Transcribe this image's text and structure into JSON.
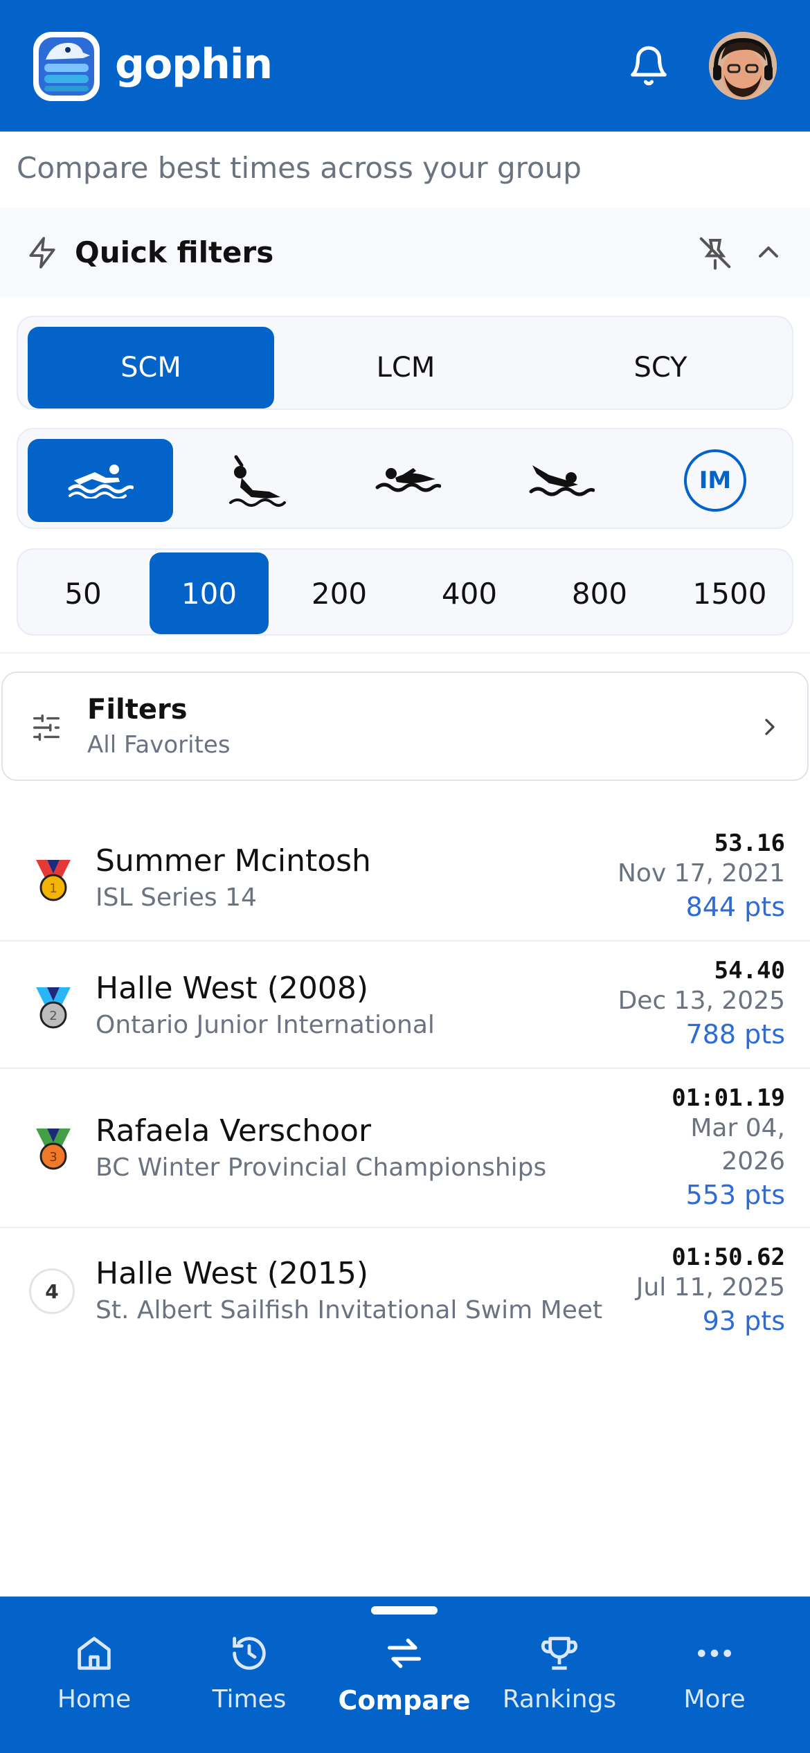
{
  "header": {
    "brand": "gophin",
    "bell_icon": "bell-icon",
    "avatar": "user-avatar"
  },
  "subtitle": "Compare best times across your group",
  "quick_filters": {
    "title": "Quick filters",
    "course": {
      "options": [
        "SCM",
        "LCM",
        "SCY"
      ],
      "selected": "SCM"
    },
    "strokes": {
      "options": [
        "freestyle-icon",
        "backstroke-icon",
        "breaststroke-icon",
        "butterfly-icon",
        "IM"
      ],
      "selected": "freestyle-icon",
      "im_label": "IM"
    },
    "distance": {
      "options": [
        "50",
        "100",
        "200",
        "400",
        "800",
        "1500"
      ],
      "selected": "100"
    }
  },
  "filters": {
    "title": "Filters",
    "subtitle": "All Favorites"
  },
  "results": [
    {
      "rank": "1",
      "name": "Summer Mcintosh",
      "meet": "ISL Series 14",
      "time": "53.16",
      "date": "Nov 17, 2021",
      "points": "844 pts"
    },
    {
      "rank": "2",
      "name": "Halle West (2008)",
      "meet": "Ontario Junior International",
      "time": "54.40",
      "date": "Dec 13, 2025",
      "points": "788 pts"
    },
    {
      "rank": "3",
      "name": "Rafaela Verschoor",
      "meet": "BC Winter Provincial Championships",
      "time": "01:01.19",
      "date_line1": "Mar 04,",
      "date_line2": "2026",
      "points": "553 pts"
    },
    {
      "rank": "4",
      "name": "Halle West (2015)",
      "meet": "St. Albert Sailfish Invitational Swim Meet",
      "time": "01:50.62",
      "date": "Jul 11, 2025",
      "points": "93 pts"
    }
  ],
  "nav": [
    {
      "label": "Home",
      "icon": "home-icon"
    },
    {
      "label": "Times",
      "icon": "history-icon"
    },
    {
      "label": "Compare",
      "icon": "compare-icon",
      "active": true
    },
    {
      "label": "Rankings",
      "icon": "trophy-icon"
    },
    {
      "label": "More",
      "icon": "more-icon"
    }
  ],
  "colors": {
    "primary": "#0463c9",
    "points": "#2d6bd6"
  }
}
